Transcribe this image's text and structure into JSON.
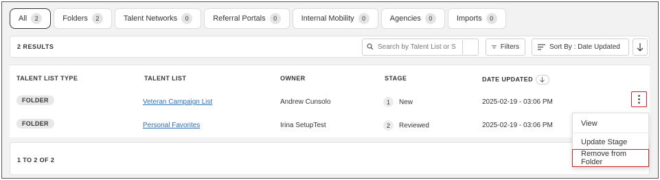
{
  "tabs": [
    {
      "label": "All",
      "count": "2",
      "active": true
    },
    {
      "label": "Folders",
      "count": "2"
    },
    {
      "label": "Talent Networks",
      "count": "0"
    },
    {
      "label": "Referral Portals",
      "count": "0"
    },
    {
      "label": "Internal Mobility",
      "count": "0"
    },
    {
      "label": "Agencies",
      "count": "0"
    },
    {
      "label": "Imports",
      "count": "0"
    }
  ],
  "results_label": "2 RESULTS",
  "search": {
    "placeholder": "Search by Talent List or S"
  },
  "filters_label": "Filters",
  "sort_label": "Sort By : Date Updated",
  "columns": [
    "TALENT LIST TYPE",
    "TALENT LIST",
    "OWNER",
    "STAGE",
    "DATE UPDATED"
  ],
  "rows": [
    {
      "type": "FOLDER",
      "list": "Veteran Campaign List",
      "owner": "Andrew Cunsolo",
      "stage_num": "1",
      "stage": "New",
      "date": "2025-02-19 - 03:06 PM"
    },
    {
      "type": "FOLDER",
      "list": "Personal Favorites",
      "owner": "Irina SetupTest",
      "stage_num": "2",
      "stage": "Reviewed",
      "date": "2025-02-19 - 03:06 PM"
    }
  ],
  "pagination": "1 TO 2 OF 2",
  "menu": {
    "view": "View",
    "update_stage": "Update Stage",
    "remove": "Remove from Folder"
  },
  "colors": {
    "accent_red": "#d0202e",
    "link": "#2f6fb4"
  }
}
